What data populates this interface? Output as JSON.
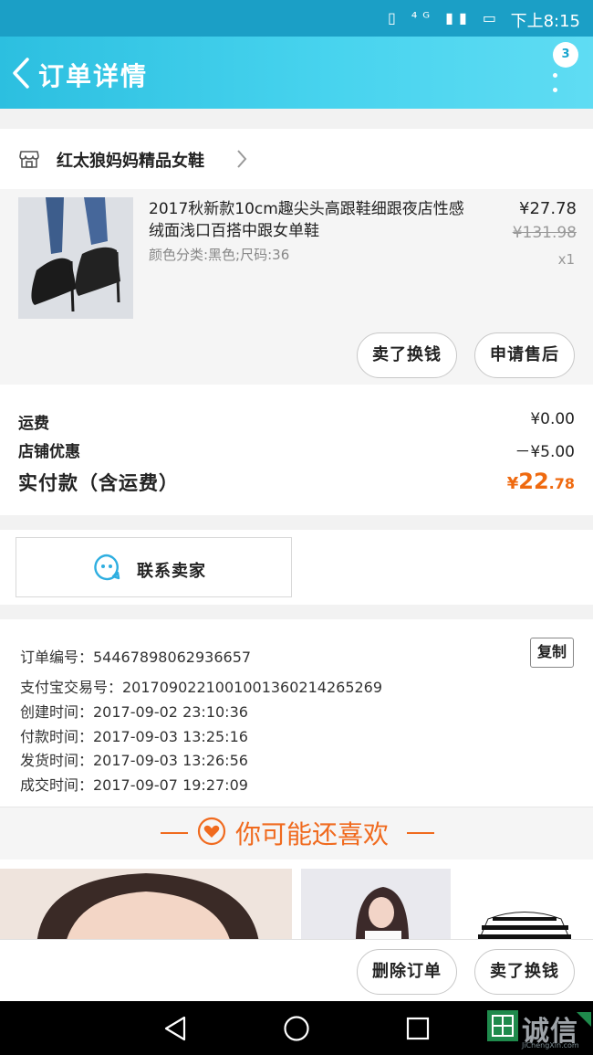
{
  "status_bar": {
    "icons": "▯ ⁴ᴳ ▮▮ ▭",
    "time": "下上8:15"
  },
  "header": {
    "title": "订单详情",
    "badge": "3"
  },
  "shop": {
    "name": "红太狼妈妈精品女鞋"
  },
  "product": {
    "title": "2017秋新款10cm趣尖头高跟鞋细跟夜店性感绒面浅口百搭中跟女单鞋",
    "sku": "颜色分类:黑色;尺码:36",
    "price": "¥27.78",
    "original_price": "¥131.98",
    "quantity": "x1"
  },
  "actions": {
    "resell": "卖了换钱",
    "after_sale": "申请售后"
  },
  "fees": {
    "shipping_label": "运费",
    "shipping_value": "¥0.00",
    "discount_label": "店铺优惠",
    "discount_value": "－¥5.00",
    "total_label": "实付款（含运费）",
    "total_currency": "¥",
    "total_int": "22",
    "total_dec": ".78"
  },
  "contact": {
    "label": "联系卖家"
  },
  "order_info": {
    "copy_label": "复制",
    "lines": [
      "订单编号：54467898062936657",
      "支付宝交易号：2017090221001001360214265269",
      "创建时间：2017-09-02 23:10:36",
      "付款时间：2017-09-03 13:25:16",
      "发货时间：2017-09-03 13:26:56",
      "成交时间：2017-09-07 19:27:09"
    ]
  },
  "recommend": {
    "title": "你可能还喜欢"
  },
  "bottom_actions": {
    "delete": "删除订单",
    "resell": "卖了换钱"
  },
  "watermark": {
    "text": "诚信",
    "sub": "JiChengXin.com"
  },
  "colors": {
    "header": "#2cbfe0",
    "accent": "#ef6a10",
    "nav": "#000000"
  }
}
